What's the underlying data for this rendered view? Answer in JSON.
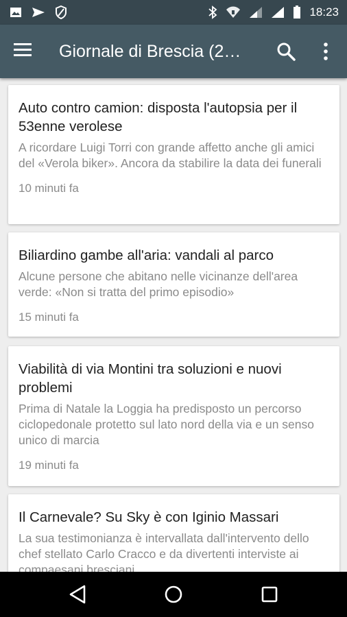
{
  "status_bar": {
    "time": "18:23",
    "icons": [
      "image-icon",
      "send-icon",
      "shield-icon",
      "bluetooth-icon",
      "wifi-icon",
      "signal-icon",
      "signal-icon",
      "battery-icon"
    ]
  },
  "app_bar": {
    "title": "Giornale di Brescia (2…",
    "icons": [
      "menu-icon",
      "search-icon",
      "more-vert-icon"
    ]
  },
  "articles": [
    {
      "title": "Auto contro camion: disposta l'autopsia per il 53enne verolese",
      "summary": "A ricordare Luigi Torri con grande affetto anche gli amici del «Verola biker». Ancora da stabilire la data dei funerali",
      "time": "10 minuti fa"
    },
    {
      "title": "Biliardino gambe all'aria: vandali al parco",
      "summary": "Alcune persone che abitano nelle vicinanze dell'area verde: «Non si tratta del primo episodio»",
      "time": "15 minuti fa"
    },
    {
      "title": "Viabilità di via Montini tra soluzioni e nuovi problemi",
      "summary": "Prima di Natale la Loggia ha predisposto un percorso ciclopedonale protetto sul lato nord della via e un senso unico di marcia",
      "time": "19 minuti fa"
    },
    {
      "title": "Il Carnevale? Su Sky è con Iginio Massari",
      "summary": "La sua testimonianza è intervallata dall'intervento dello chef stellato Carlo Cracco e da divertenti interviste ai compaesani bresciani",
      "time": ""
    }
  ],
  "nav_bar": {
    "icons": [
      "back-icon",
      "home-icon",
      "recents-icon"
    ]
  },
  "colors": {
    "status_bar": "#37474f",
    "app_bar": "#455a64",
    "background": "#eeeeee",
    "card": "#ffffff",
    "title_text": "#212121",
    "secondary_text": "#8a8a8a"
  }
}
